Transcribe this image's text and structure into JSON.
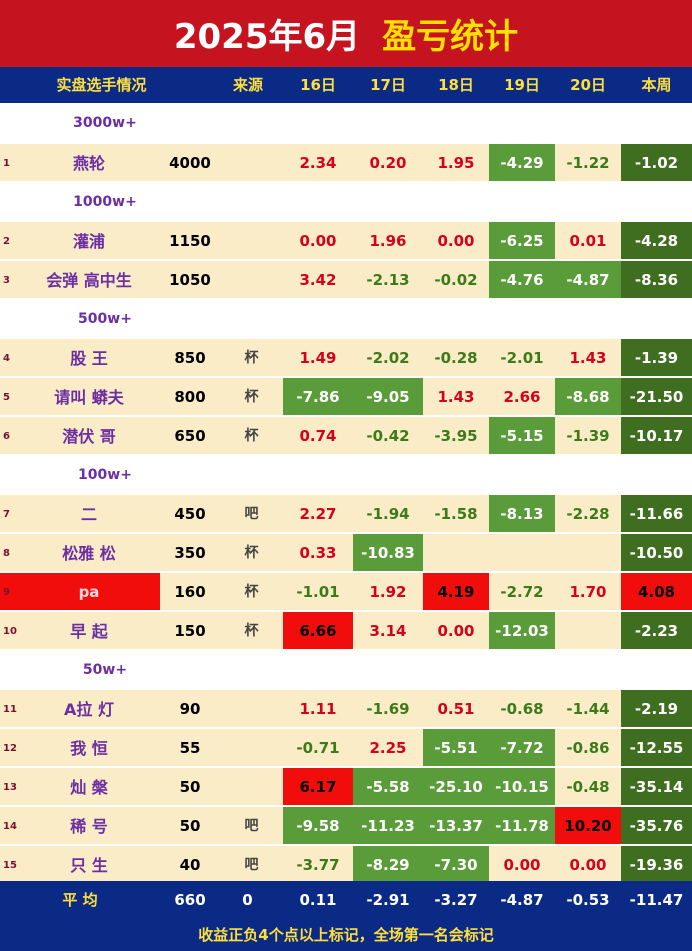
{
  "banner": {
    "title": "2025年6月",
    "subtitle": "盈亏统计"
  },
  "header": [
    "实盘选手情况",
    "来源",
    "16日",
    "17日",
    "18日",
    "19日",
    "20日",
    "本周"
  ],
  "sections": [
    "3000w+",
    "1000w+",
    "500w+",
    "100w+",
    "50w+"
  ],
  "rows": [
    {
      "idx": "1",
      "name": "燕轮",
      "capital": "4000",
      "src": "",
      "vals": [
        "2.34",
        "0.20",
        "1.95",
        "-4.29",
        "-1.22",
        "-1.02"
      ]
    },
    {
      "idx": "2",
      "name": "灌浦",
      "capital": "1150",
      "src": "",
      "vals": [
        "0.00",
        "1.96",
        "0.00",
        "-6.25",
        "0.01",
        "-4.28"
      ]
    },
    {
      "idx": "3",
      "name": "会弹    高中生",
      "capital": "1050",
      "src": "",
      "vals": [
        "3.42",
        "-2.13",
        "-0.02",
        "-4.76",
        "-4.87",
        "-8.36"
      ]
    },
    {
      "idx": "4",
      "name": "股   王",
      "capital": "850",
      "src": "杯",
      "vals": [
        "1.49",
        "-2.02",
        "-0.28",
        "-2.01",
        "1.43",
        "-1.39"
      ]
    },
    {
      "idx": "5",
      "name": "请叫    蟒夫",
      "capital": "800",
      "src": "杯",
      "vals": [
        "-7.86",
        "-9.05",
        "1.43",
        "2.66",
        "-8.68",
        "-21.50"
      ]
    },
    {
      "idx": "6",
      "name": "潜伏   哥",
      "capital": "650",
      "src": "杯",
      "vals": [
        "0.74",
        "-0.42",
        "-3.95",
        "-5.15",
        "-1.39",
        "-10.17"
      ]
    },
    {
      "idx": "7",
      "name": "二",
      "capital": "450",
      "src": "吧",
      "vals": [
        "2.27",
        "-1.94",
        "-1.58",
        "-8.13",
        "-2.28",
        "-11.66"
      ]
    },
    {
      "idx": "8",
      "name": "松雅    松",
      "capital": "350",
      "src": "杯",
      "vals": [
        "0.33",
        "-10.83",
        "",
        "",
        "",
        "-10.50"
      ]
    },
    {
      "idx": "9",
      "name": "pa",
      "capital": "160",
      "src": "杯",
      "vals": [
        "-1.01",
        "1.92",
        "4.19",
        "-2.72",
        "1.70",
        "4.08"
      ]
    },
    {
      "idx": "10",
      "name": "早   起",
      "capital": "150",
      "src": "杯",
      "vals": [
        "6.66",
        "3.14",
        "0.00",
        "-12.03",
        "",
        "-2.23"
      ]
    },
    {
      "idx": "11",
      "name": "A拉   灯",
      "capital": "90",
      "src": "",
      "vals": [
        "1.11",
        "-1.69",
        "0.51",
        "-0.68",
        "-1.44",
        "-2.19"
      ]
    },
    {
      "idx": "12",
      "name": "我   恒",
      "capital": "55",
      "src": "",
      "vals": [
        "-0.71",
        "2.25",
        "-5.51",
        "-7.72",
        "-0.86",
        "-12.55"
      ]
    },
    {
      "idx": "13",
      "name": "灿    槃",
      "capital": "50",
      "src": "",
      "vals": [
        "6.17",
        "-5.58",
        "-25.10",
        "-10.15",
        "-0.48",
        "-35.14"
      ]
    },
    {
      "idx": "14",
      "name": "稀   号",
      "capital": "50",
      "src": "吧",
      "vals": [
        "-9.58",
        "-11.23",
        "-13.37",
        "-11.78",
        "10.20",
        "-35.76"
      ]
    },
    {
      "idx": "15",
      "name": "只    生",
      "capital": "40",
      "src": "吧",
      "vals": [
        "-3.77",
        "-8.29",
        "-7.30",
        "0.00",
        "0.00",
        "-19.36"
      ]
    }
  ],
  "average": {
    "label": "平  均",
    "capital": "660",
    "src": "0",
    "vals": [
      "0.11",
      "-2.91",
      "-3.27",
      "-4.87",
      "-0.53",
      "-11.47"
    ]
  },
  "footer": "收益正负4个点以上标记，全场第一名会标记",
  "colors": {
    "banner": "#c5141f",
    "header": "#0a2a86",
    "cream": "#fbecc8",
    "green": "#5a9c3a",
    "dark_green": "#3f6e21",
    "red": "#f20d0d"
  }
}
